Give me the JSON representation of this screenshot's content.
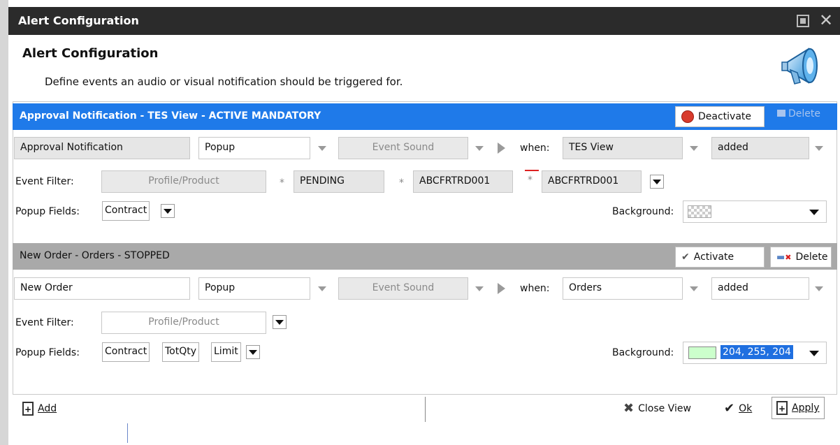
{
  "window": {
    "title": "Alert Configuration"
  },
  "header": {
    "title": "Alert Configuration",
    "subtitle": "Define events an audio or visual notification should be triggered for."
  },
  "alerts": [
    {
      "header": "Approval Notification - TES View - ACTIVE MANDATORY",
      "status": "active",
      "toggle_button": "Deactivate",
      "delete_button": "Delete",
      "name": "Approval Notification",
      "type": "Popup",
      "sound": "Event Sound",
      "when_label": "when:",
      "view": "TES View",
      "event": "added",
      "filter_label": "Event Filter:",
      "filters": [
        "Profile/Product",
        "PENDING",
        "ABCFRTRD001",
        "ABCFRTRD001"
      ],
      "popup_fields_label": "Popup Fields:",
      "popup_fields": [
        "Contract"
      ],
      "background_label": "Background:",
      "background_value": ""
    },
    {
      "header": "New Order - Orders - STOPPED",
      "status": "stopped",
      "toggle_button": "Activate",
      "delete_button": "Delete",
      "name": "New Order",
      "type": "Popup",
      "sound": "Event Sound",
      "when_label": "when:",
      "view": "Orders",
      "event": "added",
      "filter_label": "Event Filter:",
      "filters": [
        "Profile/Product"
      ],
      "popup_fields_label": "Popup Fields:",
      "popup_fields": [
        "Contract",
        "TotQty",
        "Limit"
      ],
      "background_label": "Background:",
      "background_value": "204, 255, 204"
    }
  ],
  "footer": {
    "add": "Add",
    "close_view": "Close View",
    "ok": "Ok",
    "apply": "Apply"
  },
  "colors": {
    "active_bar": "#1f7ae9",
    "stopped_bar": "#a9a9a9",
    "title_bar": "#2b2b2b",
    "swatch": "#ccffcc"
  }
}
